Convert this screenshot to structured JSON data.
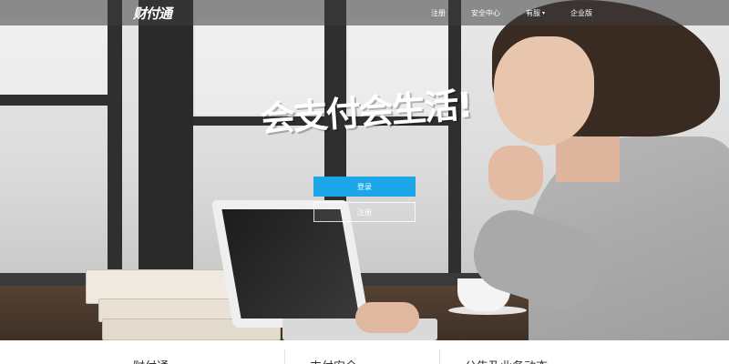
{
  "brand": {
    "logo_text": "财付通"
  },
  "nav": {
    "items": [
      {
        "label": "注册"
      },
      {
        "label": "安全中心"
      },
      {
        "label": "有服",
        "has_dropdown": true
      },
      {
        "label": "企业版"
      }
    ],
    "caret": "▾"
  },
  "hero": {
    "slogan": "会支付会生活!",
    "login_label": "登录",
    "register_label": "注册",
    "login_color": "#1ba6e8"
  },
  "bottom": {
    "columns": [
      {
        "title": "财付通"
      },
      {
        "title": "支付安全"
      },
      {
        "title": "公告及业务动态"
      }
    ]
  }
}
